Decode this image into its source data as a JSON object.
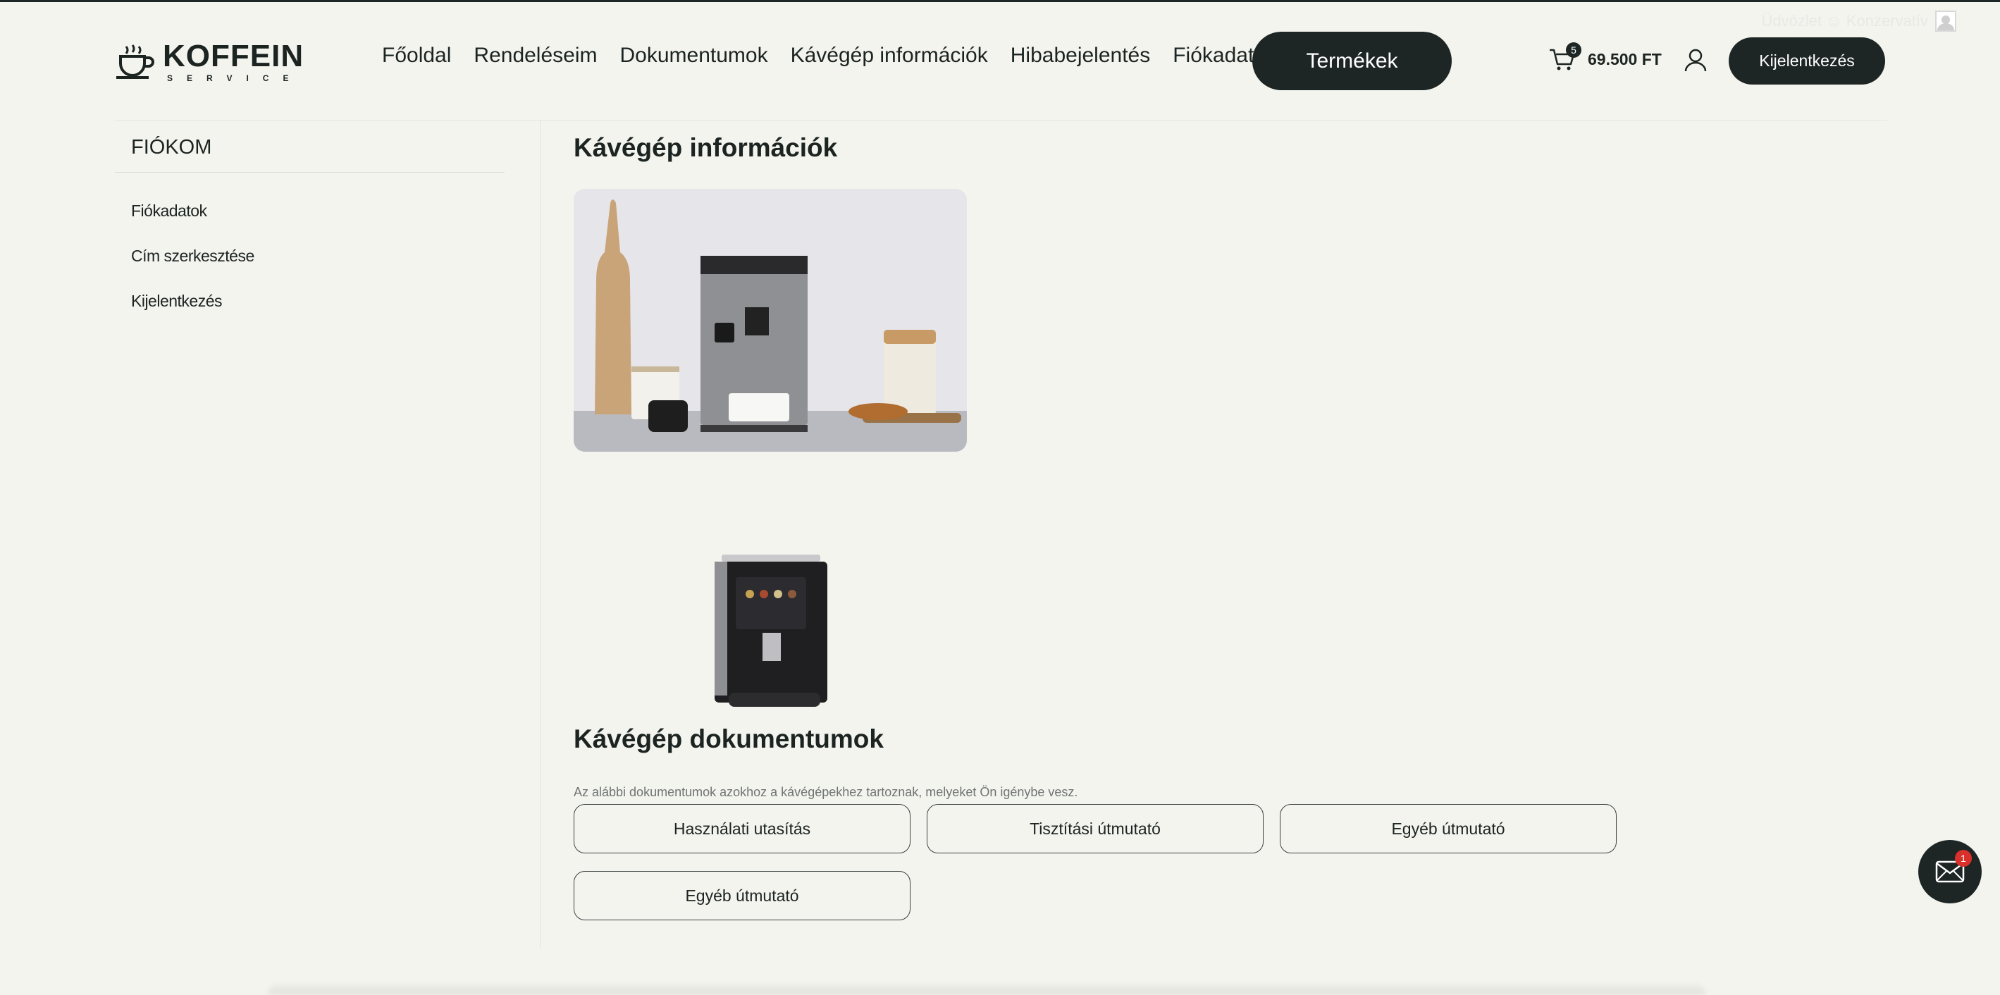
{
  "greeting": {
    "text": "Üdvözlet ☺ Konzervatív"
  },
  "brand": {
    "name": "KOFFEIN",
    "subtitle": "SERVICE"
  },
  "nav": {
    "items": [
      {
        "label": "Főoldal"
      },
      {
        "label": "Rendeléseim"
      },
      {
        "label": "Dokumentumok"
      },
      {
        "label": "Kávégép információk"
      },
      {
        "label": "Hibabejelentés"
      },
      {
        "label": "Fiókadatok"
      }
    ],
    "products_button": "Termékek"
  },
  "cart": {
    "count": "5",
    "total": "69.500 FT",
    "icon": "cart-icon"
  },
  "account": {
    "icon": "user-icon",
    "logout_button": "Kijelentkezés"
  },
  "sidebar": {
    "title": "FIÓKOM",
    "items": [
      {
        "label": "Fiókadatok"
      },
      {
        "label": "Cím szerkesztése"
      },
      {
        "label": "Kijelentkezés"
      }
    ]
  },
  "main": {
    "title": "Kávégép információk",
    "docs_title": "Kávégép dokumentumok",
    "docs_description": "Az alábbi dokumentumok azokhoz a kávégépekhez tartoznak, melyeket Ön igénybe vesz.",
    "doc_buttons": [
      {
        "label": "Használati utasítás"
      },
      {
        "label": "Tisztítási útmutató"
      },
      {
        "label": "Egyéb útmutató"
      },
      {
        "label": "Egyéb útmutató"
      }
    ]
  },
  "chat": {
    "badge": "1",
    "icon": "mail-icon"
  },
  "colors": {
    "dark": "#1d2624",
    "background": "#f4f4ef",
    "badge_red": "#d9302c"
  }
}
